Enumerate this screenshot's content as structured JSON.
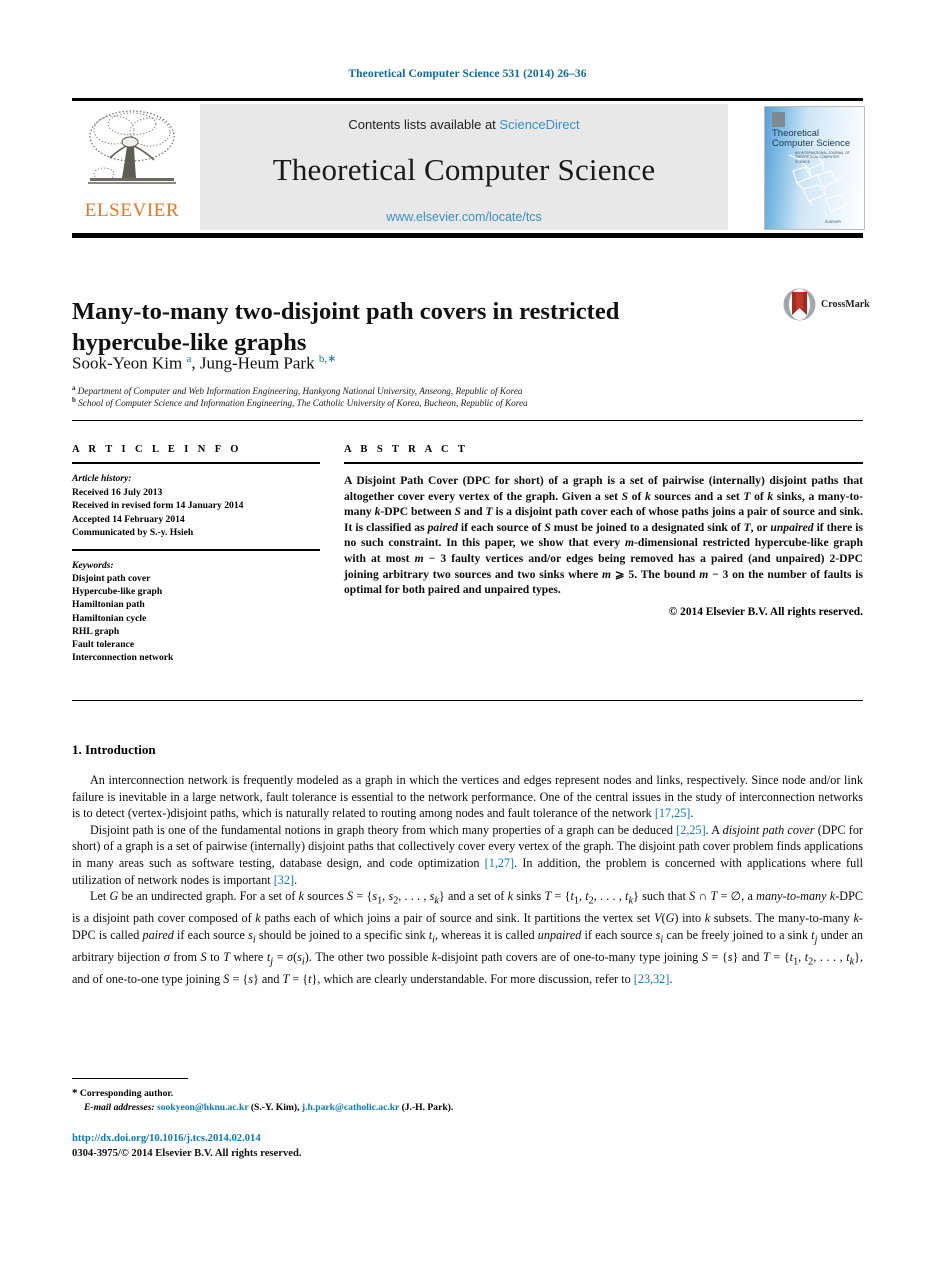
{
  "running_head": "Theoretical Computer Science 531 (2014) 26–36",
  "masthead": {
    "contents_prefix": "Contents lists available at ",
    "sciencedirect": "ScienceDirect",
    "journal_title": "Theoretical Computer Science",
    "journal_url": "www.elsevier.com/locate/tcs",
    "publisher": "ELSEVIER",
    "cover": {
      "title_line1": "Theoretical",
      "title_line2": "Computer Science",
      "subtitle": "AN INTERNATIONAL JOURNAL OF THEORETICAL COMPUTER SCIENCE",
      "footer": "ELSEVIER"
    }
  },
  "article": {
    "title": "Many-to-many two-disjoint path covers in restricted hypercube-like graphs",
    "authors_html": "Sook-Yeon Kim <sup>a</sup>, Jung-Heum Park <sup>b,</sup><sup>∗</sup>",
    "affiliation_a_marker": "a",
    "affiliation_a": "Department of Computer and Web Information Engineering, Hankyong National University, Anseong, Republic of Korea",
    "affiliation_b_marker": "b",
    "affiliation_b": "School of Computer Science and Information Engineering, The Catholic University of Korea, Bucheon, Republic of Korea",
    "crossmark_label": "CrossMark"
  },
  "article_info": {
    "heading": "A R T I C L E    I N F O",
    "history_heading": "Article history:",
    "history": [
      "Received 16 July 2013",
      "Received in revised form 14 January 2014",
      "Accepted 14 February 2014",
      "Communicated by S.-y. Hsieh"
    ],
    "keywords_heading": "Keywords:",
    "keywords": [
      "Disjoint path cover",
      "Hypercube-like graph",
      "Hamiltonian path",
      "Hamiltonian cycle",
      "RHL graph",
      "Fault tolerance",
      "Interconnection network"
    ]
  },
  "abstract": {
    "heading": "A B S T R A C T",
    "body_html": "A Disjoint Path Cover (DPC for short) of a graph is a set of pairwise (internally) disjoint paths that altogether cover every vertex of the graph. Given a set <i>S</i> of <i>k</i> sources and a set <i>T</i> of <i>k</i> sinks, a many-to-many <i>k</i>-DPC between <i>S</i> and <i>T</i> is a disjoint path cover each of whose paths joins a pair of source and sink. It is classified as <i>paired</i> if each source of <i>S</i> must be joined to a designated sink of <i>T</i>, or <i>unpaired</i> if there is no such constraint. In this paper, we show that every <i>m</i>-dimensional restricted hypercube-like graph with at most <i>m</i> − 3 faulty vertices and/or edges being removed has a paired (and unpaired) 2-DPC joining arbitrary two sources and two sinks where <i>m</i> ⩾ 5. The bound <i>m</i> − 3 on the number of faults is optimal for both paired and unpaired types.",
    "copyright": "© 2014 Elsevier B.V. All rights reserved."
  },
  "introduction": {
    "number_title": "1. Introduction",
    "paragraphs_html": [
      "An interconnection network is frequently modeled as a graph in which the vertices and edges represent nodes and links, respectively. Since node and/or link failure is inevitable in a large network, fault tolerance is essential to the network performance. One of the central issues in the study of interconnection networks is to detect (vertex-)disjoint paths, which is naturally related to routing among nodes and fault tolerance of the network <span class=\"ref\">[17,25]</span>.",
      "Disjoint path is one of the fundamental notions in graph theory from which many properties of a graph can be deduced <span class=\"ref\">[2,25]</span>. A <i>disjoint path cover</i> (DPC for short) of a graph is a set of pairwise (internally) disjoint paths that collectively cover every vertex of the graph. The disjoint path cover problem finds applications in many areas such as software testing, database design, and code optimization <span class=\"ref\">[1,27]</span>. In addition, the problem is concerned with applications where full utilization of network nodes is important <span class=\"ref\">[32]</span>.",
      "Let <i>G</i> be an undirected graph. For a set of <i>k</i> sources <i>S</i> = {<i>s</i><sub>1</sub>, <i>s</i><sub>2</sub>, . . . , <i>s<sub>k</sub></i>} and a set of <i>k</i> sinks <i>T</i> = {<i>t</i><sub>1</sub>, <i>t</i><sub>2</sub>, . . . , <i>t<sub>k</sub></i>} such that <i>S</i> ∩ <i>T</i> = ∅, a <i>many-to-many k</i>-DPC is a disjoint path cover composed of <i>k</i> paths each of which joins a pair of source and sink. It partitions the vertex set <i>V</i>(<i>G</i>) into <i>k</i> subsets. The many-to-many <i>k</i>-DPC is called <i>paired</i> if each source <i>s<sub>i</sub></i> should be joined to a specific sink <i>t<sub>i</sub></i>, whereas it is called <i>unpaired</i> if each source <i>s<sub>i</sub></i> can be freely joined to a sink <i>t<sub>j</sub></i> under an arbitrary bijection <i>σ</i> from <i>S</i> to <i>T</i> where <i>t<sub>j</sub></i> = <i>σ</i>(<i>s<sub>i</sub></i>). The other two possible <i>k</i>-disjoint path covers are of one-to-many type joining <i>S</i> = {<i>s</i>} and <i>T</i> = {<i>t</i><sub>1</sub>, <i>t</i><sub>2</sub>, . . . , <i>t<sub>k</sub></i>}, and of one-to-one type joining <i>S</i> = {<i>s</i>} and <i>T</i> = {<i>t</i>}, which are clearly understandable. For more discussion, refer to <span class=\"ref\">[23,32]</span>."
    ]
  },
  "footer": {
    "corresponding_marker": "*",
    "corresponding_author": "Corresponding author.",
    "email_label": "E-mail addresses:",
    "email_1": "sookyeon@hknu.ac.kr",
    "email_1_owner": "(S.-Y. Kim),",
    "email_2": "j.h.park@catholic.ac.kr",
    "email_2_owner": "(J.-H. Park).",
    "doi": "http://dx.doi.org/10.1016/j.tcs.2014.02.014",
    "issn_copyright": "0304-3975/© 2014 Elsevier B.V. All rights reserved."
  },
  "colors": {
    "link": "#0b7bb5",
    "sciencedirect": "#3c8fc4",
    "elsevier_orange": "#e87722",
    "running_head": "#0b6ca0"
  }
}
